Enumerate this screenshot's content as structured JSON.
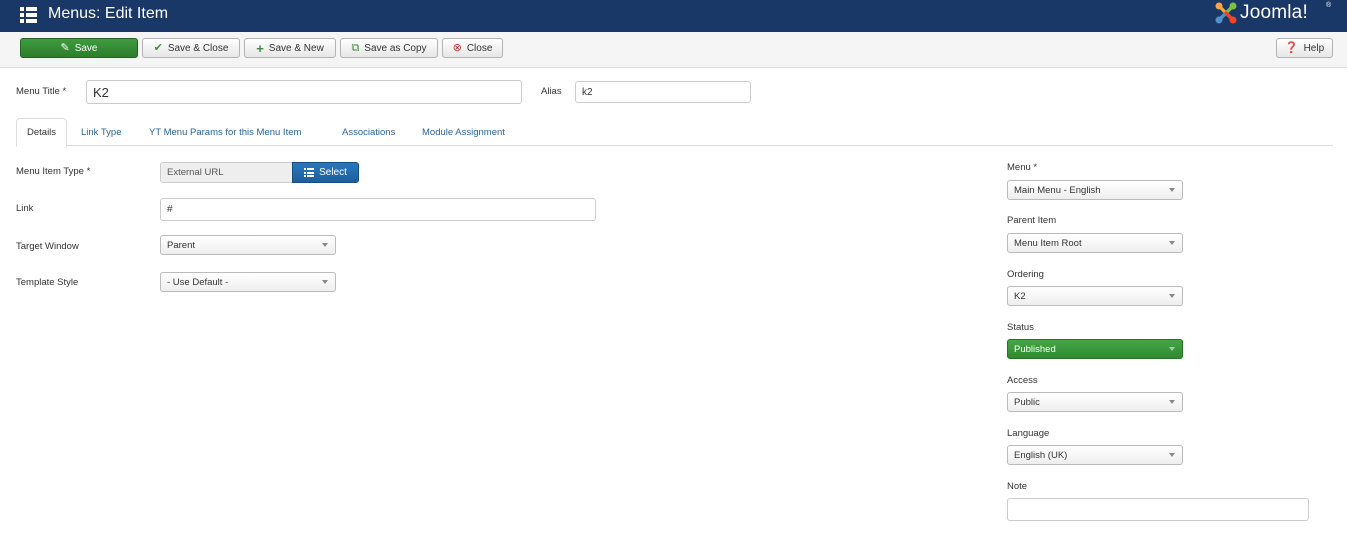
{
  "header": {
    "title": "Menus: Edit Item",
    "logo_text": "Joomla!",
    "logo_reg": "®"
  },
  "toolbar": {
    "save": "Save",
    "save_close": "Save & Close",
    "save_new": "Save & New",
    "save_copy": "Save as Copy",
    "close": "Close",
    "help": "Help"
  },
  "form": {
    "menu_title_label": "Menu Title *",
    "menu_title_value": "K2",
    "alias_label": "Alias",
    "alias_value": "k2"
  },
  "tabs": [
    "Details",
    "Link Type",
    "YT Menu Params for this Menu Item",
    "Associations",
    "Module Assignment"
  ],
  "details": {
    "item_type_label": "Menu Item Type *",
    "item_type_value": "External URL",
    "select_label": "Select",
    "link_label": "Link",
    "link_value": "#",
    "target_label": "Target Window",
    "target_value": "Parent",
    "template_label": "Template Style",
    "template_value": "- Use Default -"
  },
  "sidebar": {
    "menu_label": "Menu *",
    "menu_value": "Main Menu - English",
    "parent_label": "Parent Item",
    "parent_value": "Menu Item Root",
    "ordering_label": "Ordering",
    "ordering_value": "K2",
    "status_label": "Status",
    "status_value": "Published",
    "access_label": "Access",
    "access_value": "Public",
    "language_label": "Language",
    "language_value": "English (UK)",
    "note_label": "Note",
    "note_value": ""
  },
  "colors": {
    "header_bg": "#1a3867",
    "save_green": "#3e9b3e",
    "select_blue": "#2a78c0",
    "published_green": "#46a546",
    "link_blue": "#2a6496"
  }
}
